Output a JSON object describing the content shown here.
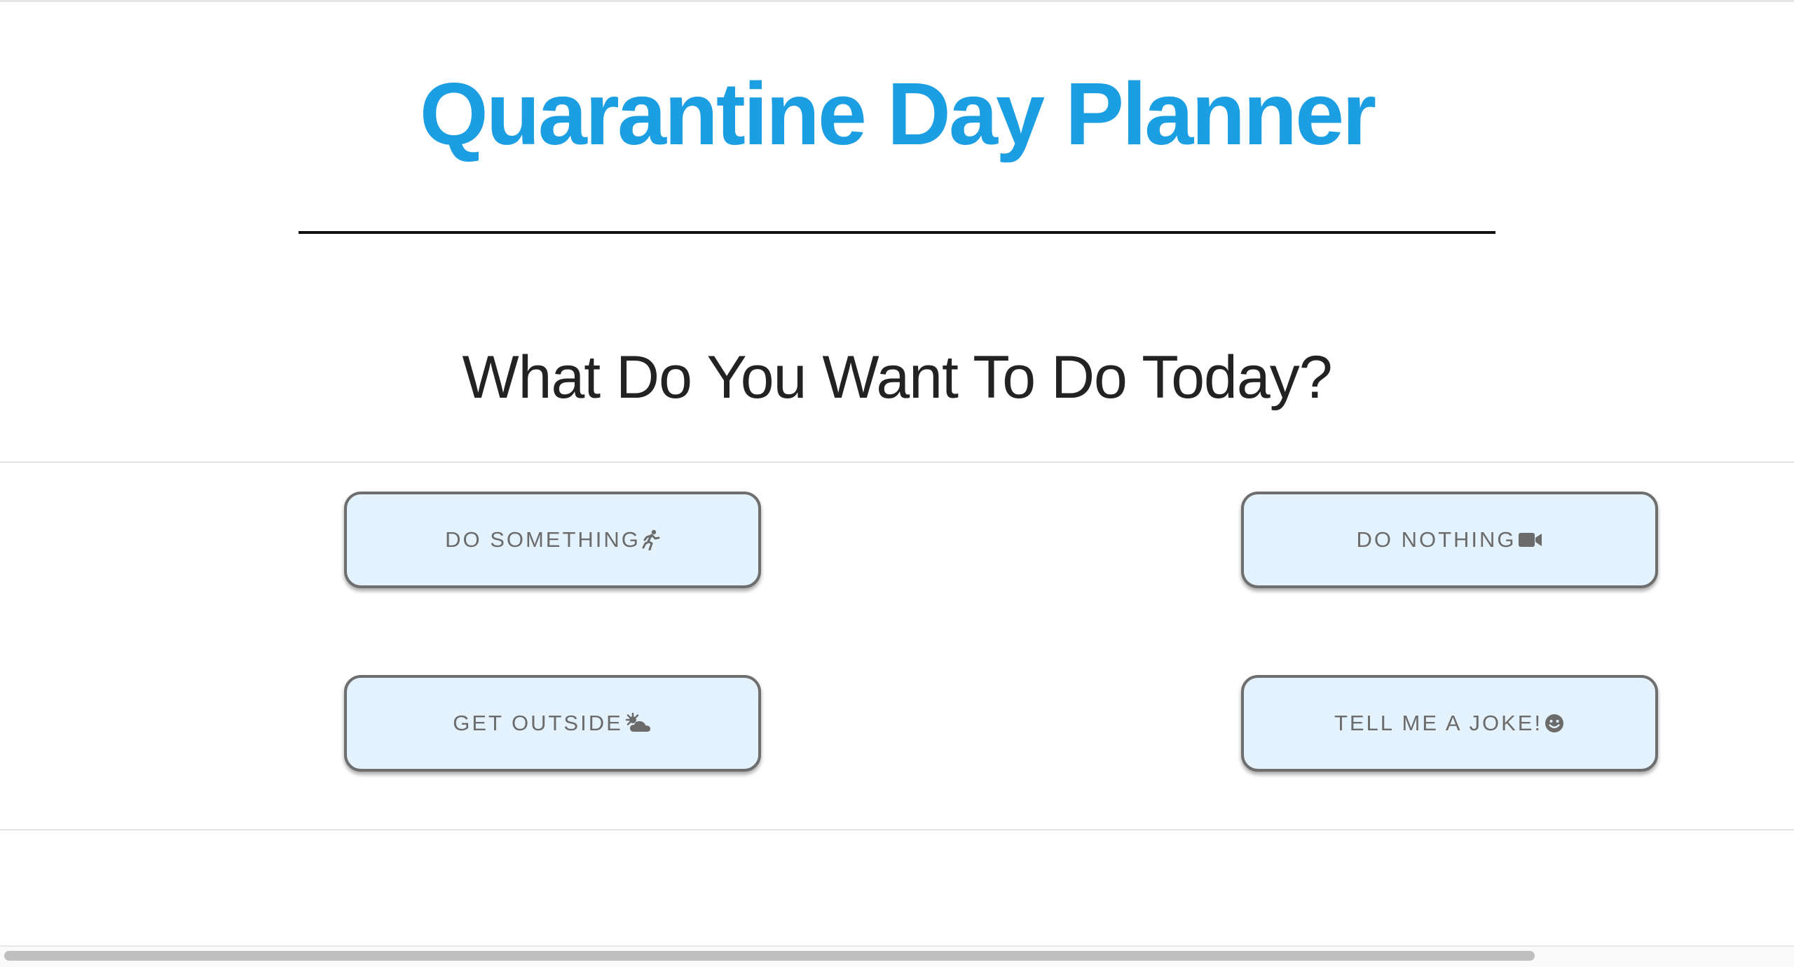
{
  "header": {
    "title": "Quarantine Day Planner",
    "subtitle": "What Do You Want To Do Today?"
  },
  "buttons": [
    {
      "label": "DO SOMETHING",
      "icon": "running-person-icon"
    },
    {
      "label": "DO NOTHING",
      "icon": "video-camera-icon"
    },
    {
      "label": "GET OUTSIDE",
      "icon": "sun-behind-cloud-icon"
    },
    {
      "label": "TELL ME A JOKE!",
      "icon": "smiley-face-icon"
    }
  ],
  "colors": {
    "title": "#1c9ee3",
    "button_bg": "#e3f2fd",
    "button_border": "#6e6e6e",
    "button_text": "#6b6b6b"
  }
}
